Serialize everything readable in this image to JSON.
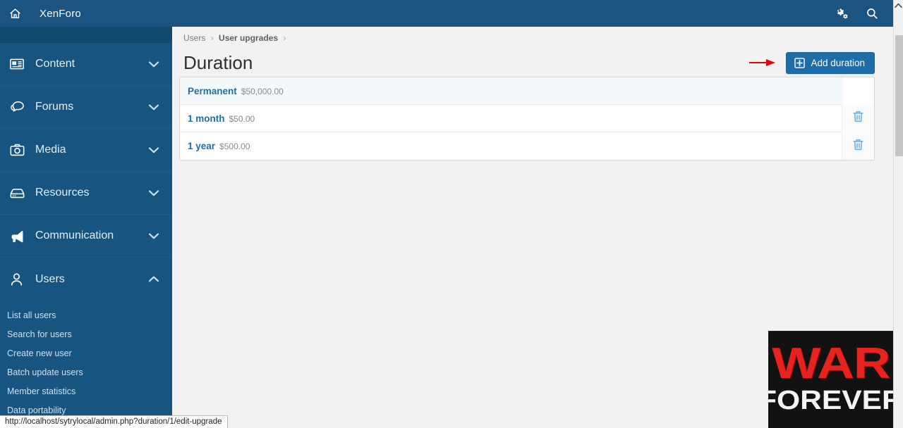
{
  "header": {
    "home_icon": "home-icon",
    "brand": "XenForo",
    "tools_icon": "cogs-icon",
    "search_icon": "search-icon"
  },
  "sidebar": {
    "items": [
      {
        "label": "Content",
        "icon": "newspaper-icon",
        "expanded": false,
        "chevron": "chevron-down-icon"
      },
      {
        "label": "Forums",
        "icon": "comments-icon",
        "expanded": false,
        "chevron": "chevron-down-icon"
      },
      {
        "label": "Media",
        "icon": "camera-icon",
        "expanded": false,
        "chevron": "chevron-down-icon"
      },
      {
        "label": "Resources",
        "icon": "database-icon",
        "expanded": false,
        "chevron": "chevron-down-icon"
      },
      {
        "label": "Communication",
        "icon": "bullhorn-icon",
        "expanded": false,
        "chevron": "chevron-down-icon"
      },
      {
        "label": "Users",
        "icon": "user-icon",
        "expanded": true,
        "chevron": "chevron-up-icon"
      }
    ],
    "users_subitems": [
      {
        "label": "List all users"
      },
      {
        "label": "Search for users"
      },
      {
        "label": "Create new user"
      },
      {
        "label": "Batch update users"
      },
      {
        "label": "Member statistics"
      },
      {
        "label": "Data portability"
      }
    ]
  },
  "content": {
    "breadcrumb": [
      {
        "label": "Users",
        "strong": false
      },
      {
        "label": "User upgrades",
        "strong": true
      }
    ],
    "breadcrumb_separator": "›",
    "title": "Duration",
    "add_button": {
      "label": "Add duration",
      "icon": "plus-square-icon"
    },
    "arrow_annotation": {
      "name": "red-arrow-annotation",
      "color": "#e3000f"
    },
    "rows": [
      {
        "title": "Permanent",
        "price": "$50,000.00",
        "highlight": true,
        "has_delete": false,
        "delete_icon": ""
      },
      {
        "title": "1 month",
        "price": "$50.00",
        "highlight": false,
        "has_delete": true,
        "delete_icon": "trash-icon"
      },
      {
        "title": "1 year",
        "price": "$500.00",
        "highlight": false,
        "has_delete": true,
        "delete_icon": "trash-icon"
      }
    ]
  },
  "statusbar": {
    "url": "http://localhost/sytrylocal/admin.php?duration/1/edit-upgrade"
  },
  "overlay": {
    "line1": "WAR",
    "line2": "FOREVER"
  },
  "colors": {
    "header_blue": "#1b5480",
    "sidebar_blue": "#175480",
    "accent_blue": "#1e6ca8",
    "link_blue": "#1f6ea5",
    "arrow_red": "#e3000f",
    "content_bg": "#f2f2f2"
  }
}
